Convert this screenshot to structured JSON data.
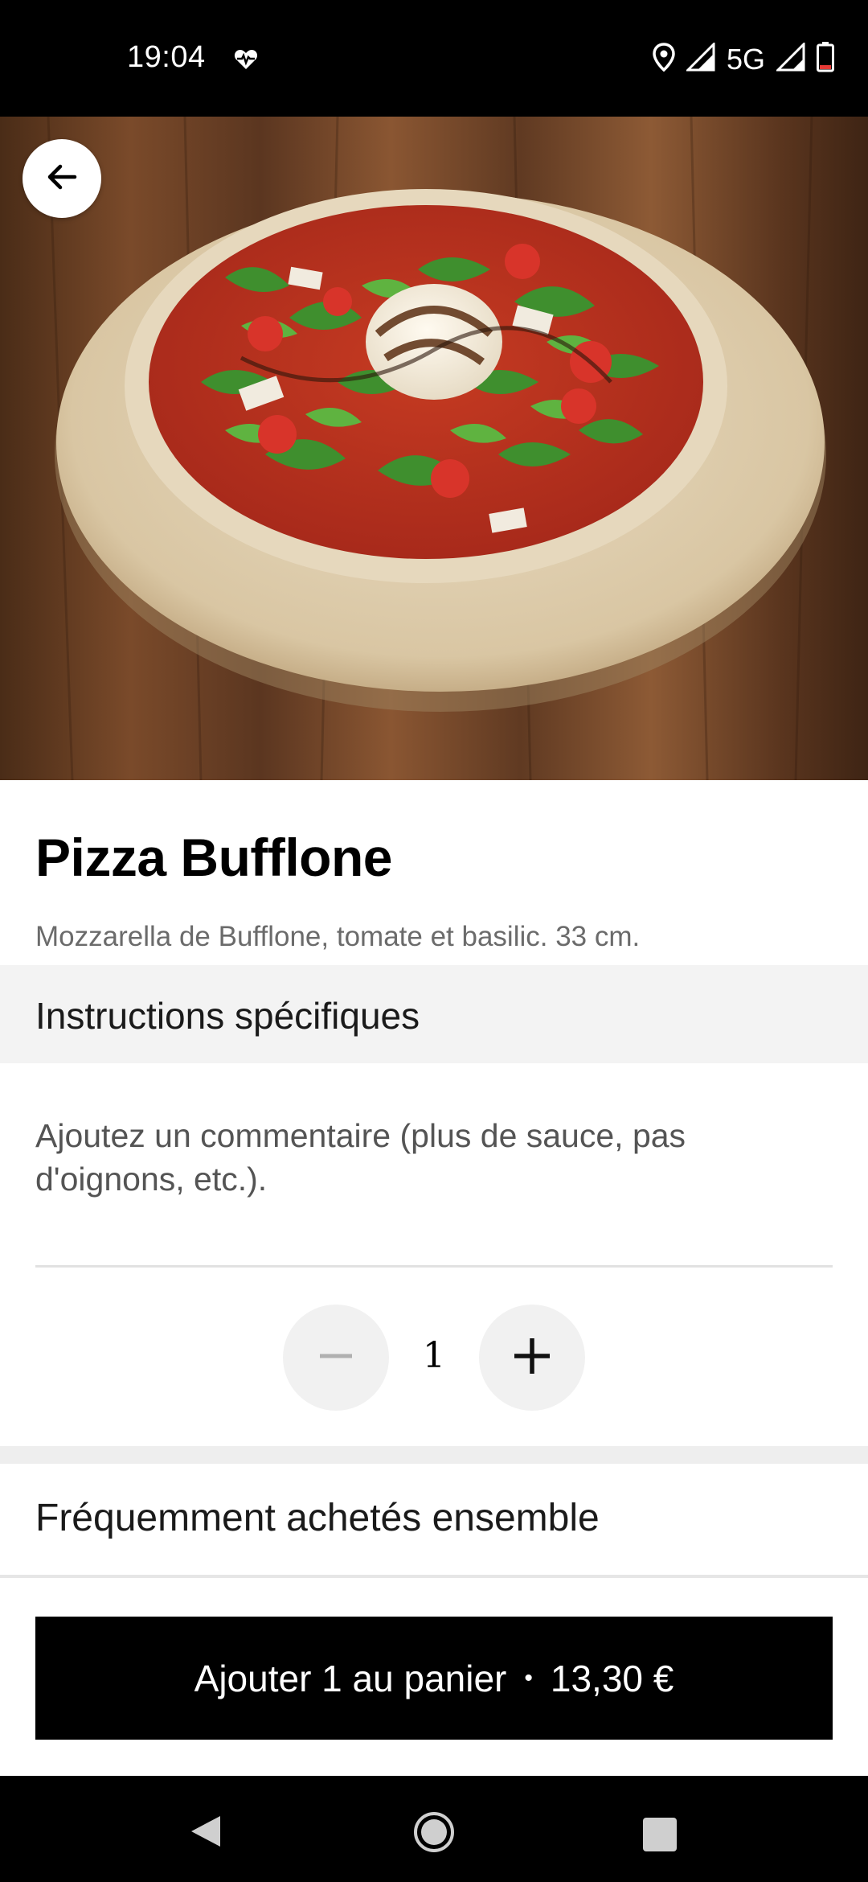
{
  "status_bar": {
    "time": "19:04",
    "network": "5G",
    "icons": [
      "heart-pulse-icon",
      "location-icon",
      "signal-icon",
      "signal-icon-2",
      "battery-low-icon"
    ]
  },
  "hero": {
    "image": "pizza-photo",
    "back_icon": "arrow-left-icon"
  },
  "product": {
    "title": "Pizza Bufflone",
    "description": "Mozzarella de Bufflone, tomate et basilic. 33 cm."
  },
  "instructions": {
    "header": "Instructions spécifiques",
    "placeholder": "Ajoutez un commentaire (plus de sauce, pas d'oignons, etc.)."
  },
  "quantity": {
    "value": "1",
    "minus_icon": "minus-icon",
    "plus_icon": "plus-icon"
  },
  "frequently_bought": {
    "label": "Fréquemment achetés ensemble"
  },
  "cart_button": {
    "label": "Ajouter 1 au panier",
    "separator": "•",
    "price": "13,30 €"
  },
  "colors": {
    "accent": "#000000",
    "section_bg": "#f3f3f3",
    "muted_text": "#6b6b6b"
  }
}
